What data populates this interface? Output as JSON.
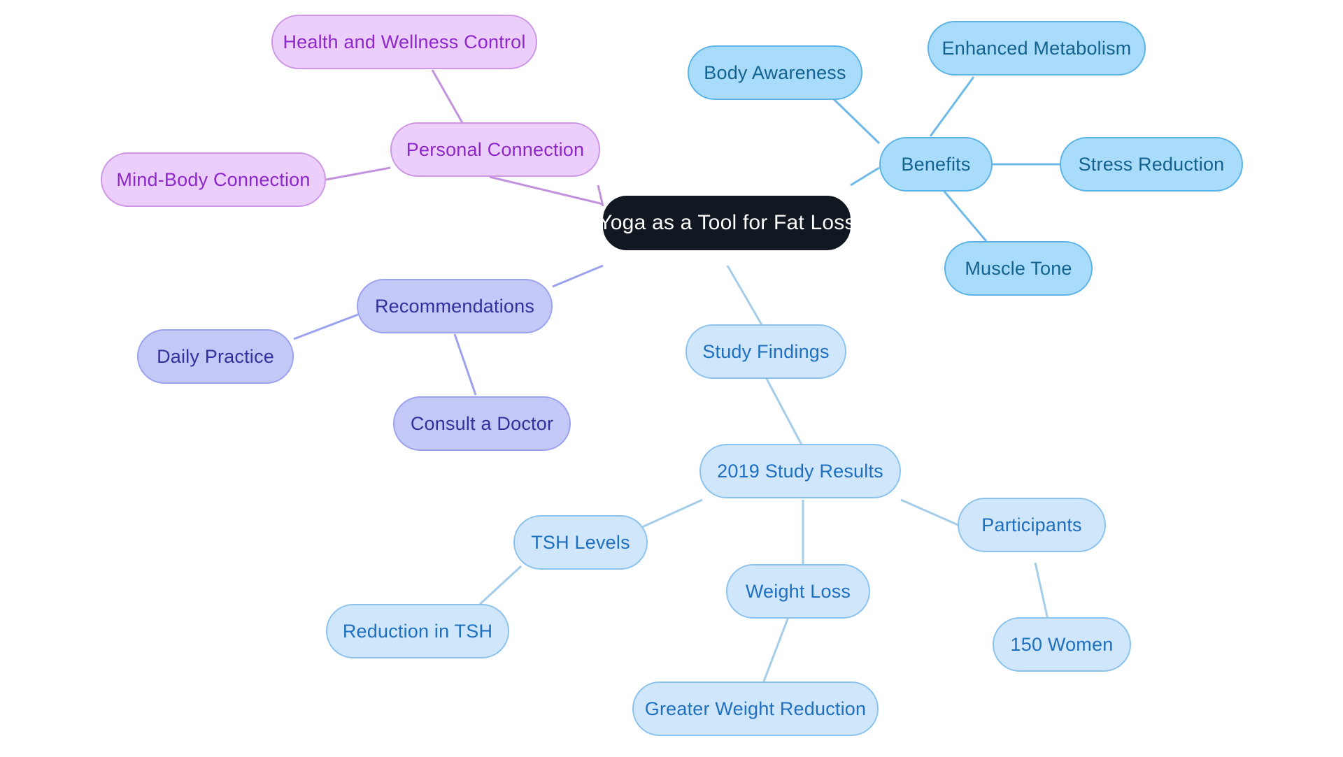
{
  "diagram": {
    "type": "mindmap",
    "title": "Yoga as a Tool for Fat Loss",
    "background_color": "#ffffff",
    "root": {
      "id": "root",
      "label": "Yoga as a Tool for Fat Loss",
      "fill": "#111821",
      "text_color": "#ffffff"
    },
    "branches": [
      {
        "id": "benefits",
        "label": "Benefits",
        "fill": "#a9dcfb",
        "border": "#5bb4e5",
        "text_color": "#14628f",
        "children": [
          {
            "id": "body-awareness",
            "label": "Body Awareness"
          },
          {
            "id": "enhanced-metabolism",
            "label": "Enhanced Metabolism"
          },
          {
            "id": "stress-reduction",
            "label": "Stress Reduction"
          },
          {
            "id": "muscle-tone",
            "label": "Muscle Tone"
          }
        ]
      },
      {
        "id": "study-findings",
        "label": "Study Findings",
        "fill": "#cfe6fb",
        "border": "#8cc3ee",
        "text_color": "#1f6fbf",
        "children": [
          {
            "id": "study-2019",
            "label": "2019 Study Results",
            "children": [
              {
                "id": "tsh-levels",
                "label": "TSH Levels",
                "children": [
                  {
                    "id": "reduction-in-tsh",
                    "label": "Reduction in TSH"
                  }
                ]
              },
              {
                "id": "weight-loss",
                "label": "Weight Loss",
                "children": [
                  {
                    "id": "greater-weight-reduction",
                    "label": "Greater Weight Reduction"
                  }
                ]
              },
              {
                "id": "participants",
                "label": "Participants",
                "children": [
                  {
                    "id": "women-150",
                    "label": "150 Women"
                  }
                ]
              }
            ]
          }
        ]
      },
      {
        "id": "recommendations",
        "label": "Recommendations",
        "fill": "#c4c8f7",
        "border": "#9ba2ee",
        "text_color": "#32319c",
        "children": [
          {
            "id": "daily-practice",
            "label": "Daily Practice"
          },
          {
            "id": "consult-a-doctor",
            "label": "Consult a Doctor"
          }
        ]
      },
      {
        "id": "personal-connection",
        "label": "Personal Connection",
        "fill": "#eccefa",
        "border": "#cd97e6",
        "text_color": "#8c27c9",
        "children": [
          {
            "id": "health-wellness-control",
            "label": "Health and Wellness Control"
          },
          {
            "id": "mind-body-connection",
            "label": "Mind-Body Connection"
          }
        ]
      }
    ],
    "nodes": {
      "root": "Yoga as a Tool for Fat Loss",
      "health_wellness": "Health and Wellness Control",
      "personal_connection": "Personal Connection",
      "mind_body": "Mind-Body Connection",
      "benefits": "Benefits",
      "body_awareness": "Body Awareness",
      "enhanced_metabolism": "Enhanced Metabolism",
      "stress_reduction": "Stress Reduction",
      "muscle_tone": "Muscle Tone",
      "recommendations": "Recommendations",
      "daily_practice": "Daily Practice",
      "consult_doctor": "Consult a Doctor",
      "study_findings": "Study Findings",
      "study_2019": "2019 Study Results",
      "tsh_levels": "TSH Levels",
      "reduction_tsh": "Reduction in TSH",
      "weight_loss": "Weight Loss",
      "greater_weight_reduction": "Greater Weight Reduction",
      "participants": "Participants",
      "women_150": "150 Women"
    },
    "edge_colors": {
      "personal": "#c392de",
      "benefits": "#6fb9e8",
      "study": "#a5cdea",
      "recommendations": "#9ba2ee"
    }
  }
}
